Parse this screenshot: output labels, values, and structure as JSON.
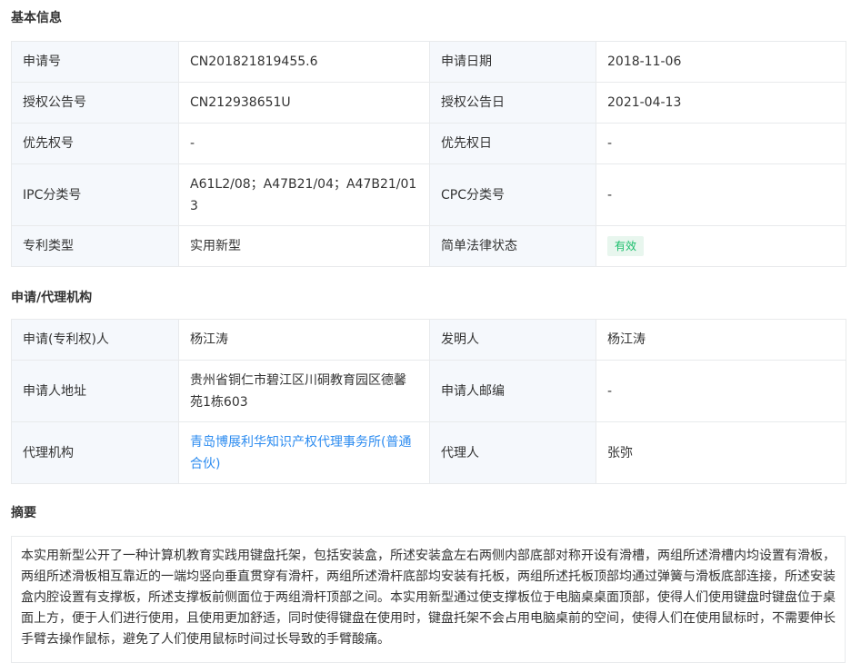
{
  "basic": {
    "title": "基本信息",
    "rows": [
      {
        "l1": "申请号",
        "v1": "CN201821819455.6",
        "l2": "申请日期",
        "v2": "2018-11-06"
      },
      {
        "l1": "授权公告号",
        "v1": "CN212938651U",
        "l2": "授权公告日",
        "v2": "2021-04-13"
      },
      {
        "l1": "优先权号",
        "v1": "-",
        "l2": "优先权日",
        "v2": "-"
      },
      {
        "l1": "IPC分类号",
        "v1": "A61L2/08；A47B21/04；A47B21/013",
        "l2": "CPC分类号",
        "v2": "-"
      },
      {
        "l1": "专利类型",
        "v1": "实用新型",
        "l2": "简单法律状态",
        "v2": "有效"
      }
    ]
  },
  "agency": {
    "title": "申请/代理机构",
    "rows": [
      {
        "l1": "申请(专利权)人",
        "v1": "杨江涛",
        "l2": "发明人",
        "v2": "杨江涛"
      },
      {
        "l1": "申请人地址",
        "v1": "贵州省铜仁市碧江区川硐教育园区德馨苑1栋603",
        "l2": "申请人邮编",
        "v2": "-"
      },
      {
        "l1": "代理机构",
        "v1": "青岛博展利华知识产权代理事务所(普通合伙)",
        "l2": "代理人",
        "v2": "张弥"
      }
    ]
  },
  "abstract": {
    "title": "摘要",
    "text": "本实用新型公开了一种计算机教育实践用键盘托架，包括安装盒，所述安装盒左右两侧内部底部对称开设有滑槽，两组所述滑槽内均设置有滑板，两组所述滑板相互靠近的一端均竖向垂直贯穿有滑杆，两组所述滑杆底部均安装有托板，两组所述托板顶部均通过弹簧与滑板底部连接，所述安装盒内腔设置有支撑板，所述支撑板前侧面位于两组滑杆顶部之间。本实用新型通过使支撑板位于电脑桌桌面顶部，使得人们使用键盘时键盘位于桌面上方，便于人们进行使用，且使用更加舒适，同时使得键盘在使用时，键盘托架不会占用电脑桌前的空间，使得人们在使用鼠标时，不需要伸长手臂去操作鼠标，避免了人们使用鼠标时间过长导致的手臂酸痛。"
  },
  "colors": {
    "label_bg": "#f5f8fc",
    "border": "#e8eaec",
    "link": "#2d8cf0",
    "status_green": "#19be6b"
  }
}
